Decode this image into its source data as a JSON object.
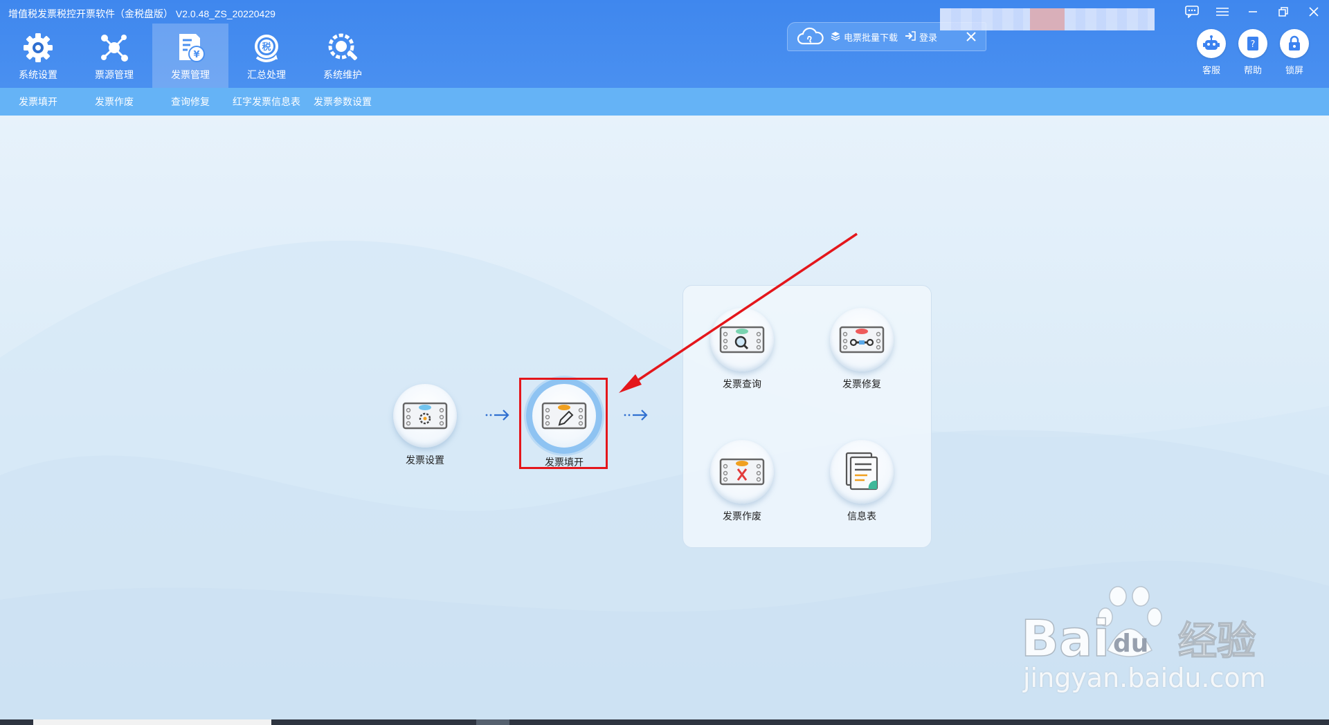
{
  "window": {
    "title": "增值税发票税控开票软件（金税盘版） V2.0.48_ZS_20220429"
  },
  "main_tabs": [
    {
      "label": "系统设置",
      "icon": "gear-icon"
    },
    {
      "label": "票源管理",
      "icon": "nodes-icon"
    },
    {
      "label": "发票管理",
      "icon": "invoice-yen-icon",
      "active": true
    },
    {
      "label": "汇总处理",
      "icon": "tax-refresh-icon"
    },
    {
      "label": "系统维护",
      "icon": "wrench-gear-icon"
    }
  ],
  "cloud_panel": {
    "download_label": "电票批量下载",
    "login_label": "登录"
  },
  "tool_buttons": [
    {
      "label": "客服",
      "icon": "robot-icon"
    },
    {
      "label": "帮助",
      "icon": "help-book-icon"
    },
    {
      "label": "锁屏",
      "icon": "lock-icon"
    }
  ],
  "sub_nav": [
    {
      "label": "发票填开"
    },
    {
      "label": "发票作废"
    },
    {
      "label": "查询修复"
    },
    {
      "label": "红字发票信息表"
    },
    {
      "label": "发票参数设置"
    }
  ],
  "flow": {
    "settings_label": "发票设置",
    "fill_label": "发票填开",
    "group": [
      {
        "label": "发票查询",
        "icon": "invoice-search-icon"
      },
      {
        "label": "发票修复",
        "icon": "invoice-repair-icon"
      },
      {
        "label": "发票作废",
        "icon": "invoice-void-icon"
      },
      {
        "label": "信息表",
        "icon": "info-sheet-icon"
      }
    ]
  },
  "watermark": {
    "brand": "Bai du 经验",
    "url": "jingyan.baidu.com"
  },
  "colors": {
    "header": "#4a90f0",
    "subnav": "#65b3f6",
    "highlight_box": "#e4161b",
    "annotation_arrow": "#e4161b"
  }
}
